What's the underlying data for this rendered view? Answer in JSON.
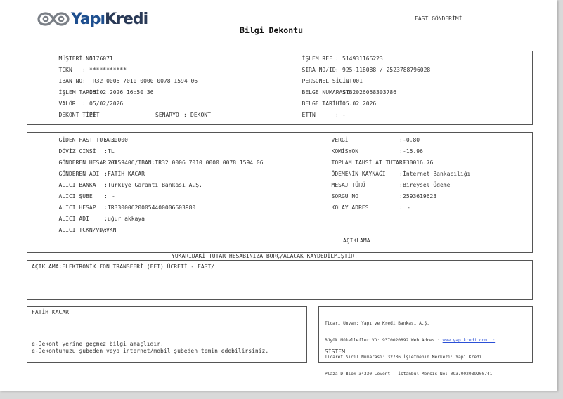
{
  "header": {
    "brand": "YapıKredi",
    "title": "Bilgi Dekontu",
    "fast_label": "FAST GÖNDERİMİ"
  },
  "section1": {
    "left": [
      {
        "label": "MÜŞTERİ NO",
        "value": "5176071"
      },
      {
        "label": "TCKN",
        "value": "***********"
      },
      {
        "label": "IBAN NO",
        "value": "TR32 0006 7010 0000 0078 1594 06"
      },
      {
        "label": "İŞLEM TARİHİ",
        "value": "05.02.2026 16:50:36"
      },
      {
        "label": "VALÖR",
        "value": "05/02/2026"
      },
      {
        "label": "DEKONT TİPİ",
        "value": "EFT"
      }
    ],
    "senaryo_label": "SENARYO",
    "senaryo_value": "DEKONT",
    "right": [
      {
        "label": "İŞLEM REF",
        "value": "514931166223"
      },
      {
        "label": "SIRA NO/ID",
        "value": "925-118088 / 2523788796028"
      },
      {
        "label": "PERSONEL SİCİL",
        "value": "INT001"
      },
      {
        "label": "BELGE NUMARASI",
        "value": "SYB2026058303786"
      },
      {
        "label": "BELGE TARİHİ",
        "value": "05.02.2026"
      },
      {
        "label": "ETTN",
        "value": "-"
      }
    ]
  },
  "section2": {
    "left": [
      {
        "label": "GİDEN FAST TUTARI",
        "value": "-30000"
      },
      {
        "label": "DÖVİZ CİNSİ",
        "value": "TL"
      },
      {
        "label": "GÖNDEREN HESAP NO",
        "value": "78159406/IBAN:TR32 0006 7010 0000 0078 1594 06"
      },
      {
        "label": "GÖNDEREN ADI",
        "value": "FATİH KACAR"
      },
      {
        "label": "ALICI BANKA",
        "value": "Türkiye Garanti Bankası A.Ş."
      },
      {
        "label": "ALICI ŞUBE",
        "value": "-"
      },
      {
        "label": "ALICI HESAP",
        "value": "TR330006200054400006603980"
      },
      {
        "label": "ALICI ADI",
        "value": "uğur akkaya"
      },
      {
        "label": "ALICI TCKN/VD/VKN",
        "value": "-"
      }
    ],
    "right": [
      {
        "label": "VERGİ",
        "value": "-0.80"
      },
      {
        "label": "KOMİSYON",
        "value": "-15.96"
      },
      {
        "label": "TOPLAM TAHSİLAT TUTARI",
        "value": "-30016.76"
      },
      {
        "label": "ÖDEMENİN KAYNAĞI",
        "value": "İnternet Bankacılığı"
      },
      {
        "label": "MESAJ TÜRÜ",
        "value": "Bireysel Ödeme"
      },
      {
        "label": "SORGU NO",
        "value": "2593619623"
      },
      {
        "label": "KOLAY ADRES",
        "value": "-"
      }
    ],
    "aciklama_label": "AÇIKLAMA"
  },
  "notice": "YUKARIDAKİ TUTAR HESABINIZA BORÇ/ALACAK KAYDEDİLMİŞTİR.",
  "description": "AÇIKLAMA:ELEKTRONİK FON TRANSFERİ (EFT) ÜCRETİ - FAST/",
  "footer_left": {
    "name": "FATİH KACAR",
    "line1": "e-Dekont yerine geçmez bilgi amaçlıdır.",
    "line2": "e-Dekontunuzu şubeden veya internet/mobil şubeden temin edebilirsiniz."
  },
  "footer_right": {
    "line1": "Ticari Unvan: Yapı ve Kredi Bankası A.Ş.",
    "line2_prefix": "Büyük Mükellefler VD: 9370020892 Web Adresi: ",
    "web": "www.yapikredi.com.tr",
    "line3": "Ticaret Sicil Numarası: 32736 İşletmenin Merkezi: Yapı Kredi",
    "line4": "Plaza D Blok 34330 Levent - İstanbul Mersis No: 0937002089200741",
    "system": "SİSTEM"
  },
  "colors": {
    "brand_blue": "#1e4f8f",
    "border": "#555555",
    "link": "#2a4fd6"
  }
}
